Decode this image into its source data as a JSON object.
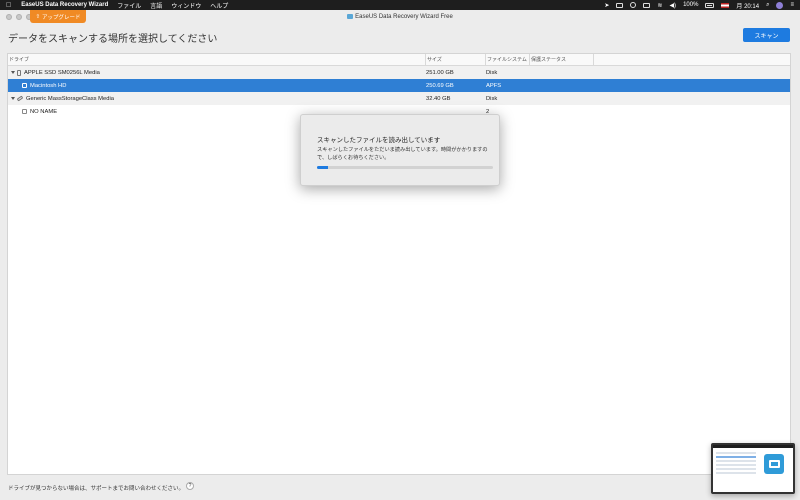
{
  "menubar": {
    "app_name": "EaseUS Data Recovery Wizard",
    "menus": [
      "ファイル",
      "言語",
      "ウィンドウ",
      "ヘルプ"
    ],
    "battery": "100%",
    "clock": "月 20:14"
  },
  "window": {
    "title": "EaseUS Data Recovery Wizard Free",
    "upgrade_label": "アップグレード"
  },
  "main": {
    "heading": "データをスキャンする場所を選択してください",
    "scan_label": "スキャン"
  },
  "table": {
    "columns": [
      "ドライブ",
      "サイズ",
      "ファイルシステム",
      "保護ステータス"
    ],
    "rows": [
      {
        "name": "APPLE SSD SM0256L Media",
        "size": "251.00 GB",
        "fs": "Disk"
      },
      {
        "name": "Macintosh HD",
        "size": "250.69 GB",
        "fs": "APFS"
      },
      {
        "name": "Generic MassStorageClass Media",
        "size": "32.40 GB",
        "fs": "Disk"
      },
      {
        "name": "NO NAME",
        "size": "",
        "fs": "2"
      }
    ]
  },
  "dialog": {
    "title": "スキャンしたファイルを読み出しています",
    "message": "スキャンしたファイルをただいま読み出しています。時間がかかりますので、しばらくお待ちください。",
    "progress_percent": 6
  },
  "footer": {
    "text": "ドライブが見つからない場合は、サポートまでお問い合わせください。",
    "help": "?"
  },
  "colors": {
    "accent": "#1e7be0",
    "selection": "#2f7fd4",
    "upgrade": "#f08a24"
  }
}
